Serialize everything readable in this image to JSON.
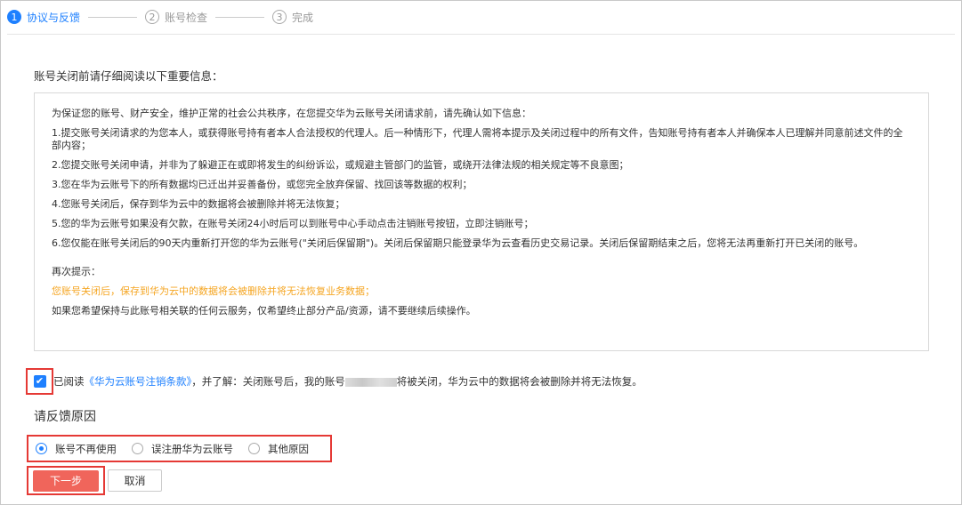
{
  "steps": [
    {
      "number": "1",
      "label": "协议与反馈",
      "state": "active"
    },
    {
      "number": "2",
      "label": "账号检查",
      "state": "pending"
    },
    {
      "number": "3",
      "label": "完成",
      "state": "pending"
    }
  ],
  "intro": "账号关闭前请仔细阅读以下重要信息：",
  "notice": {
    "lines": [
      "为保证您的账号、财产安全，维护正常的社会公共秩序，在您提交华为云账号关闭请求前，请先确认如下信息：",
      "1.提交账号关闭请求的为您本人，或获得账号持有者本人合法授权的代理人。后一种情形下，代理人需将本提示及关闭过程中的所有文件，告知账号持有者本人并确保本人已理解并同意前述文件的全部内容；",
      "2.您提交账号关闭申请，并非为了躲避正在或即将发生的纠纷诉讼，或规避主管部门的监管，或绕开法律法规的相关规定等不良意图；",
      "3.您在华为云账号下的所有数据均已迁出并妥善备份，或您完全放弃保留、找回该等数据的权利；",
      "4.您账号关闭后，保存到华为云中的数据将会被删除并将无法恢复；",
      "5.您的华为云账号如果没有欠款，在账号关闭24小时后可以到账号中心手动点击注销账号按钮，立即注销账号；",
      "6.您仅能在账号关闭后的90天内重新打开您的华为云账号(\"关闭后保留期\")。关闭后保留期只能登录华为云查看历史交易记录。关闭后保留期结束之后，您将无法再重新打开已关闭的账号。"
    ],
    "reminder_title": "再次提示：",
    "reminder_warning": "您账号关闭后，保存到华为云中的数据将会被删除并将无法恢复业务数据；",
    "reminder_note": "如果您希望保持与此账号相关联的任何云服务，仅希望终止部分产品/资源，请不要继续后续操作。"
  },
  "agreement": {
    "checked": true,
    "prefix": "已阅读",
    "link": "《华为云账号注销条款》",
    "middle": "，并了解：关闭账号后，我的账号",
    "suffix": "将被关闭，华为云中的数据将会被删除并将无法恢复。"
  },
  "feedback": {
    "title": "请反馈原因",
    "options": [
      {
        "label": "账号不再使用",
        "checked": true
      },
      {
        "label": "误注册华为云账号",
        "checked": false
      },
      {
        "label": "其他原因",
        "checked": false
      }
    ]
  },
  "buttons": {
    "next": "下一步",
    "cancel": "取消"
  },
  "colors": {
    "accent": "#1e80ff",
    "primary_button": "#f0655b",
    "warning_text": "#f5a623",
    "highlight_border": "#e53935"
  }
}
